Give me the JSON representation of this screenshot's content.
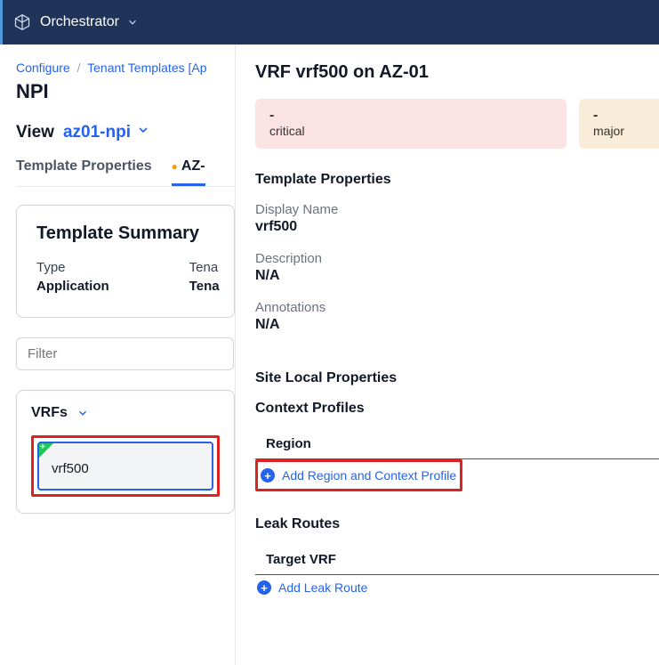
{
  "header": {
    "product": "Orchestrator"
  },
  "breadcrumb": {
    "configure": "Configure",
    "templates": "Tenant Templates [Ap"
  },
  "page": {
    "title": "NPI"
  },
  "view": {
    "label": "View",
    "value": "az01-npi"
  },
  "tabs": {
    "template_props": "Template Properties",
    "az": "AZ-"
  },
  "summary": {
    "title": "Template Summary",
    "type_label": "Type",
    "type_value": "Application",
    "tenant_label": "Tena",
    "tenant_value": "Tena"
  },
  "filter": {
    "placeholder": "Filter"
  },
  "vrfs": {
    "title": "VRFs",
    "item0": "vrf500"
  },
  "panel": {
    "title": "VRF vrf500 on AZ-01",
    "alerts": {
      "critical_count": "-",
      "critical_label": "critical",
      "major_count": "-",
      "major_label": "major"
    },
    "template_props_h": "Template Properties",
    "display_name_label": "Display Name",
    "display_name_value": "vrf500",
    "description_label": "Description",
    "description_value": "N/A",
    "annotations_label": "Annotations",
    "annotations_value": "N/A",
    "site_local_h": "Site Local Properties",
    "context_profiles_h": "Context Profiles",
    "region_col": "Region",
    "add_region": "Add Region and Context Profile",
    "leak_routes_h": "Leak Routes",
    "target_vrf_col": "Target VRF",
    "add_leak": "Add Leak Route"
  }
}
